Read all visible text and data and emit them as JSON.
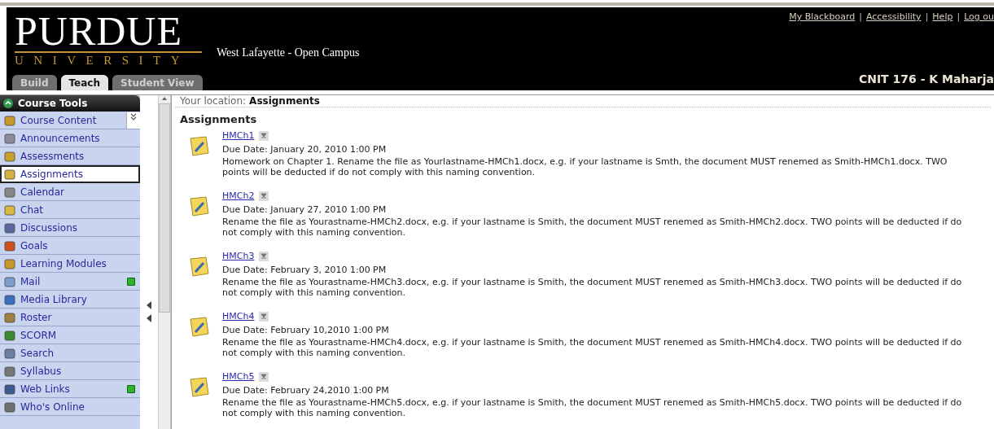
{
  "header": {
    "logo_title": "PURDUE",
    "logo_subtitle": "UNIVERSITY",
    "campus": "West Lafayette - Open Campus",
    "links": [
      "My Blackboard",
      "Accessibility",
      "Help",
      "Log ou"
    ],
    "link_separator": "|",
    "course_title": "CNIT 176 - K Maharja"
  },
  "tabs": [
    {
      "label": "Build",
      "selected": false
    },
    {
      "label": "Teach",
      "selected": true
    },
    {
      "label": "Student View",
      "selected": false
    }
  ],
  "sidebar": {
    "title": "Course Tools",
    "items": [
      {
        "label": "Course Content",
        "selected": false,
        "new": false
      },
      {
        "label": "Announcements",
        "selected": false,
        "new": false
      },
      {
        "label": "Assessments",
        "selected": false,
        "new": false
      },
      {
        "label": "Assignments",
        "selected": true,
        "new": false
      },
      {
        "label": "Calendar",
        "selected": false,
        "new": false
      },
      {
        "label": "Chat",
        "selected": false,
        "new": false
      },
      {
        "label": "Discussions",
        "selected": false,
        "new": false
      },
      {
        "label": "Goals",
        "selected": false,
        "new": false
      },
      {
        "label": "Learning Modules",
        "selected": false,
        "new": false
      },
      {
        "label": "Mail",
        "selected": false,
        "new": true
      },
      {
        "label": "Media Library",
        "selected": false,
        "new": false
      },
      {
        "label": "Roster",
        "selected": false,
        "new": false
      },
      {
        "label": "SCORM",
        "selected": false,
        "new": false
      },
      {
        "label": "Search",
        "selected": false,
        "new": false
      },
      {
        "label": "Syllabus",
        "selected": false,
        "new": false
      },
      {
        "label": "Web Links",
        "selected": false,
        "new": true
      },
      {
        "label": "Who's Online",
        "selected": false,
        "new": false
      }
    ]
  },
  "location": {
    "label": "Your location:",
    "value": "Assignments"
  },
  "heading": "Assignments",
  "assignments": [
    {
      "title": "HMCh1",
      "due": "Due Date: January 20, 2010 1:00 PM",
      "description": "Homework on Chapter 1. Rename the file as Yourlastname-HMCh1.docx, e.g. if your lastname is Smth, the document MUST renemed as Smith-HMCh1.docx. TWO points will be deducted if do not comply with this naming convention."
    },
    {
      "title": "HMCh2",
      "due": "Due Date: January 27, 2010 1:00 PM",
      "description": "Rename the file as Yourastname-HMCh2.docx, e.g. if your lastname is Smith, the document MUST renemed as Smith-HMCh2.docx. TWO points will be deducted if do not comply with this naming convention."
    },
    {
      "title": "HMCh3",
      "due": "Due Date: February 3, 2010 1:00 PM",
      "description": "Rename the file as Yourastname-HMCh3.docx, e.g. if your lastname is Smith, the document MUST renemed as Smith-HMCh3.docx. TWO points will be deducted if do not comply with this naming convention."
    },
    {
      "title": "HMCh4",
      "due": "Due Date: February 10,2010 1:00 PM",
      "description": "Rename the file as Yourastname-HMCh4.docx, e.g. if your lastname is Smith, the document MUST renemed as Smith-HMCh4.docx. TWO points will be deducted if do not comply with this naming convention."
    },
    {
      "title": "HMCh5",
      "due": "Due Date: February 24,2010 1:00 PM",
      "description": "Rename the file as Yourastname-HMCh5.docx, e.g. if your lastname is Smith, the document MUST renemed as Smith-HMCh5.docx. TWO points will be deducted if do not comply with this naming convention."
    }
  ]
}
